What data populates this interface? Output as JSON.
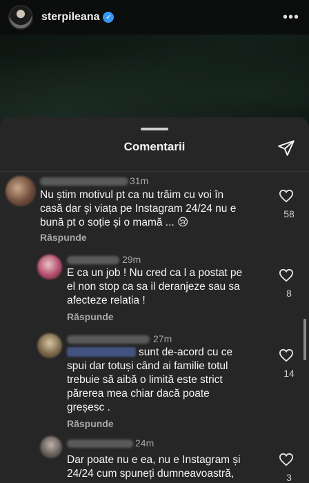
{
  "post": {
    "username": "sterpileana",
    "verified_icon": "verified-badge-icon",
    "more_label": "•••"
  },
  "sheet": {
    "title": "Comentarii",
    "share_icon": "send-icon"
  },
  "comments": [
    {
      "time": "31m",
      "text_lines": [
        "Nu știm motivul pt ca nu trăim cu voi în",
        "casă dar și viața pe Instagram 24/24 nu e",
        "bună pt o soție și o mamă ... 😢"
      ],
      "reply_label": "Răspunde",
      "likes": "58"
    },
    {
      "time": "29m",
      "text_lines": [
        "E ca un job ! Nu cred ca l a postat pe",
        "el non stop ca sa il deranjeze sau sa",
        "afecteze relatia !"
      ],
      "reply_label": "Răspunde",
      "likes": "8"
    },
    {
      "time": "27m",
      "text_lines": [
        "sunt de-acord cu ce",
        "spui dar totuși când ai familie totul",
        "trebuie să aibă o limită este strict",
        "părerea mea chiar dacă  poate",
        "greșesc ."
      ],
      "reply_label": "Răspunde",
      "likes": "14"
    },
    {
      "time": "24m",
      "text_lines": [
        "Dar poate nu e ea, nu e Instagram și",
        "24/24 cum spuneți dumneavoastră,"
      ],
      "likes": "3"
    }
  ]
}
